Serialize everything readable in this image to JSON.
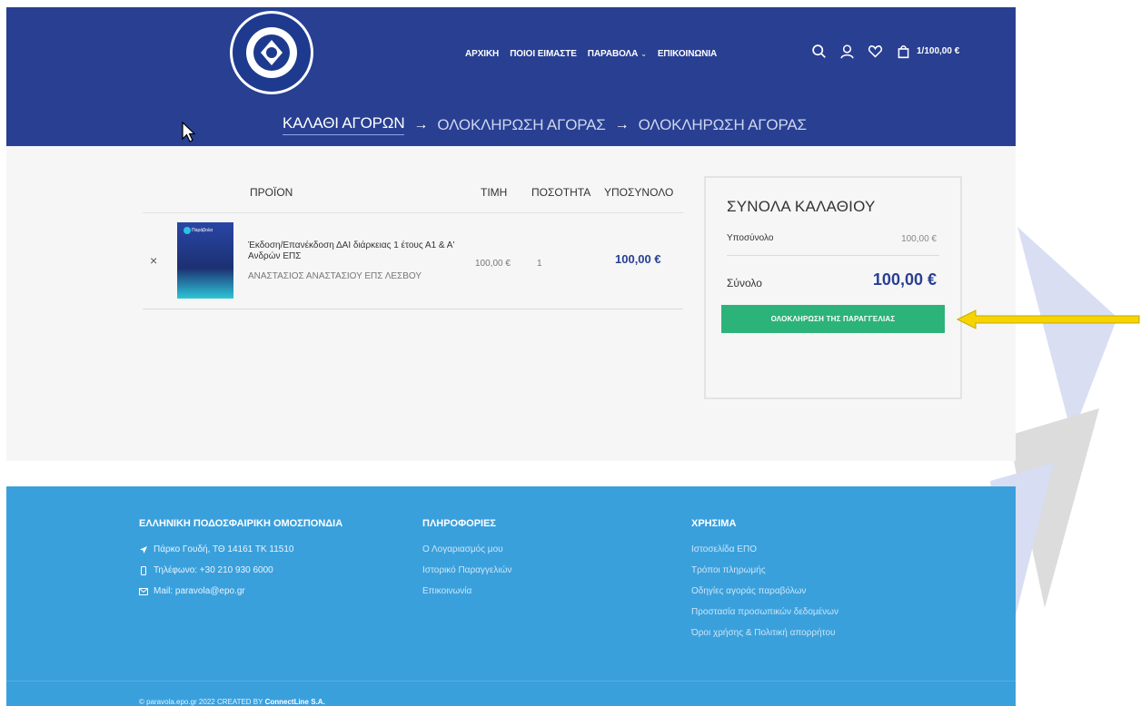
{
  "header": {
    "logo_alt": "ΕΛΛΗΝΙΚΗ ΠΟΔΟΣΦΑΙΡΙΚΗ ΟΜΟΣΠΟΝΔΙΑ",
    "nav": [
      {
        "label": "ΑΡΧΙΚΗ"
      },
      {
        "label": "ΠΟΙΟΙ ΕΙΜΑΣΤΕ"
      },
      {
        "label": "ΠΑΡΑΒΟΛΑ",
        "has_dropdown": true
      },
      {
        "label": "ΕΠΙΚΟΙΝΩΝΙΑ"
      }
    ],
    "tools": {
      "search_icon": "search-icon",
      "account_icon": "user-icon",
      "wishlist_icon": "heart-icon",
      "cart_icon": "bag-icon",
      "cart_summary": "1/100,00 €"
    },
    "steps": [
      {
        "label": "ΚΑΛΑΘΙ ΑΓΟΡΩΝ",
        "active": true
      },
      {
        "label": "ΟΛΟΚΛΗΡΩΣΗ ΑΓΟΡΑΣ"
      },
      {
        "label": "ΟΛΟΚΛΗΡΩΣΗ ΑΓΟΡΑΣ"
      }
    ],
    "step_separator": "→"
  },
  "cart": {
    "columns": {
      "product": "ΠΡΟΪΟΝ",
      "price": "ΤΙΜΗ",
      "quantity": "ΠΟΣΟΤΗΤΑ",
      "subtotal": "ΥΠΟΣΥΝΟΛΟ"
    },
    "items": [
      {
        "remove": "×",
        "thumb_label": "Παράβολα",
        "name": "Έκδοση/Επανέκδοση ΔΑΙ διάρκειας 1 έτους Α1 & Α' Ανδρών ΕΠΣ",
        "meta": "ΑΝΑΣΤΑΣΙΟΣ ΑΝΑΣΤΑΣΙΟΥ ΕΠΣ ΛΕΣΒΟΥ",
        "price": "100,00 €",
        "quantity": "1",
        "subtotal": "100,00 €"
      }
    ]
  },
  "totals": {
    "title": "ΣΥΝΟΛΑ ΚΑΛΑΘΙΟΥ",
    "subtotal_label": "Υποσύνολο",
    "subtotal_value": "100,00 €",
    "total_label": "Σύνολο",
    "total_value": "100,00 €",
    "checkout_label": "ΟΛΟΚΛΗΡΩΣΗ ΤΗΣ ΠΑΡΑΓΓΕΛΙΑΣ"
  },
  "footer": {
    "col1": {
      "title": "ΕΛΛΗΝΙΚΗ ΠΟΔΟΣΦΑΙΡΙΚΗ ΟΜΟΣΠΟΝΔΙΑ",
      "address": "Πάρκο Γουδή, ΤΘ 14161 ΤΚ 11510",
      "phone": "Τηλέφωνο: +30 210 930 6000",
      "mail": "Mail: paravola@epo.gr"
    },
    "col2": {
      "title": "ΠΛΗΡΟΦΟΡΙΕΣ",
      "links": [
        "Ο Λογαριασμός μου",
        "Ιστορικό Παραγγελιών",
        "Επικοινωνία"
      ]
    },
    "col3": {
      "title": "ΧΡΗΣΙΜΑ",
      "links": [
        "Ιστοσελίδα ΕΠΟ",
        "Τρόποι πληρωμής",
        "Οδηγίες αγοράς παραβόλων",
        "Προστασία προσωπικών δεδομένων",
        "Όροι χρήσης & Πολιτική απορρήτου"
      ]
    },
    "copyright_prefix": "© paravola.epo.gr 2022 CREATED BY ",
    "copyright_company": "ConnectLine S.A."
  },
  "colors": {
    "header_bg": "#283f92",
    "footer_bg": "#3aa0dc",
    "checkout_btn": "#2cb37a",
    "price_accent": "#283f92",
    "annotation_arrow": "#f5d400"
  }
}
